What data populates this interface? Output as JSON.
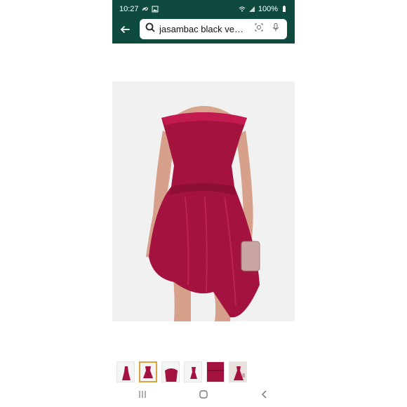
{
  "status_bar": {
    "time": "10:27",
    "battery": "100%",
    "icons": [
      "link-icon",
      "gallery-icon",
      "wifi-icon",
      "signal-icon",
      "battery-icon"
    ]
  },
  "header": {
    "search_text": "jasambac black velv...",
    "icons": [
      "back-arrow-icon",
      "search-icon",
      "camera-lens-icon",
      "microphone-icon"
    ]
  },
  "product": {
    "image_icon": "velvet-dress-photo",
    "thumbnails_count": 6,
    "selected_thumbnail_index": 1
  },
  "colors": {
    "header_bg": "#0f4a3f",
    "dress": "#a4123f",
    "thumb_selected": "#d9a441"
  },
  "nav": {
    "items": [
      "recent-apps-icon",
      "home-icon",
      "back-icon"
    ]
  }
}
